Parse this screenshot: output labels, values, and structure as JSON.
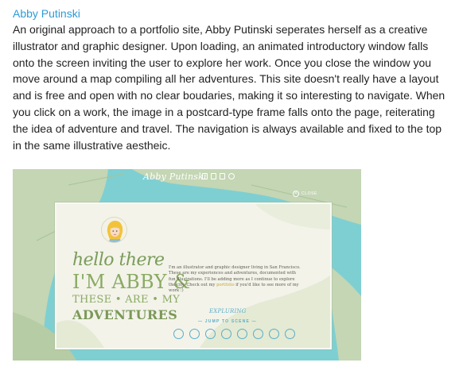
{
  "post": {
    "title": "Abby Putinski",
    "body": "An original approach to a portfolio site, Abby Putinski seperates herself as a creative illustrator and graphic designer. Upon loading, an animated introductory window falls onto the screen inviting the user to explore her work. Once you close the window you move around a map compiling all her adventures. This site doesn't really have a layout and is free and open with no clear boudaries, making it so interesting to navigate. When you click on a work, the image in a postcard-type frame falls onto the page, reiterating the idea of adventure and travel. The navigation is always available and fixed to the top in the same illustrative aestheic."
  },
  "screenshot": {
    "site_logo": "Abby Putinski",
    "close_label": "CLOSE",
    "close_glyph": "×",
    "nav_icons": [
      "grid-icon",
      "book-icon",
      "document-icon",
      "globe-icon"
    ],
    "postcard": {
      "hello": "hello there",
      "im_abby": "I'M ABBY &",
      "these_are_my": "THESE • ARE • MY",
      "adventures": "ADVENTURES",
      "intro_before_link": "I'm an illustrator and graphic designer living in San Francisco. These are my experiences and adventures, documented with fun illustrations. I'll be adding more as I continue to explore the city. Check out my ",
      "intro_link": "portfolio",
      "intro_after_link": " if you'd like to see more of my work :)",
      "exploring": "EXPLURING",
      "jump_to_scene": "— JUMP TO SCENE —",
      "scene_icons": [
        "bridge-icon",
        "tower-icon",
        "balloon-icon",
        "person-icon",
        "skyline-icon",
        "building-icon",
        "arch-icon",
        "circle-icon"
      ]
    },
    "colors": {
      "water": "#7ecfd2",
      "land": "#c4d6b4",
      "postcard": "#f3f3ea",
      "hello_green": "#7a9c5a",
      "title_blue": "#2e9bd6"
    }
  }
}
